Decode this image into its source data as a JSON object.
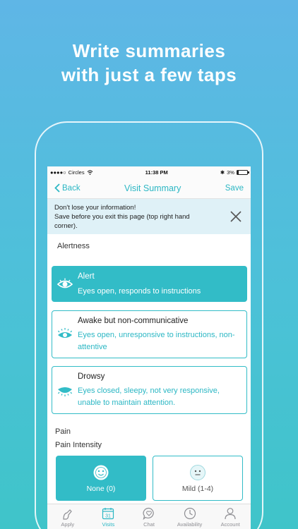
{
  "headline": {
    "line1": "Write summaries",
    "line2": "with just a few taps"
  },
  "status": {
    "carrier": "Circles",
    "time": "11:38 PM",
    "battery": "3%"
  },
  "nav": {
    "back_label": "Back",
    "title": "Visit Summary",
    "save_label": "Save"
  },
  "banner": {
    "line1": "Don't lose your information!",
    "line2": "Save before you exit this page (top right hand corner)."
  },
  "alertness": {
    "label": "Alertness",
    "options": [
      {
        "title": "Alert",
        "desc": "Eyes open, responds to instructions",
        "selected": true
      },
      {
        "title": "Awake but non-communicative",
        "desc": "Eyes open, unresponsive to instructions, non-attentive",
        "selected": false
      },
      {
        "title": "Drowsy",
        "desc": "Eyes closed, sleepy, not very responsive, unable to maintain attention.",
        "selected": false
      }
    ]
  },
  "pain": {
    "label": "Pain",
    "intensity_label": "Pain Intensity",
    "options": [
      {
        "label": "None (0)",
        "selected": true
      },
      {
        "label": "Mild (1-4)",
        "selected": false
      }
    ]
  },
  "tabs": [
    {
      "label": "Apply",
      "icon": "apply-icon",
      "active": false
    },
    {
      "label": "Visits",
      "icon": "calendar-icon",
      "active": true,
      "badge": "31"
    },
    {
      "label": "Chat",
      "icon": "chat-heart-icon",
      "active": false
    },
    {
      "label": "Availability",
      "icon": "clock-icon",
      "active": false
    },
    {
      "label": "Account",
      "icon": "user-icon",
      "active": false
    }
  ],
  "colors": {
    "accent": "#32bcc7",
    "banner_bg": "#dff1f7"
  }
}
